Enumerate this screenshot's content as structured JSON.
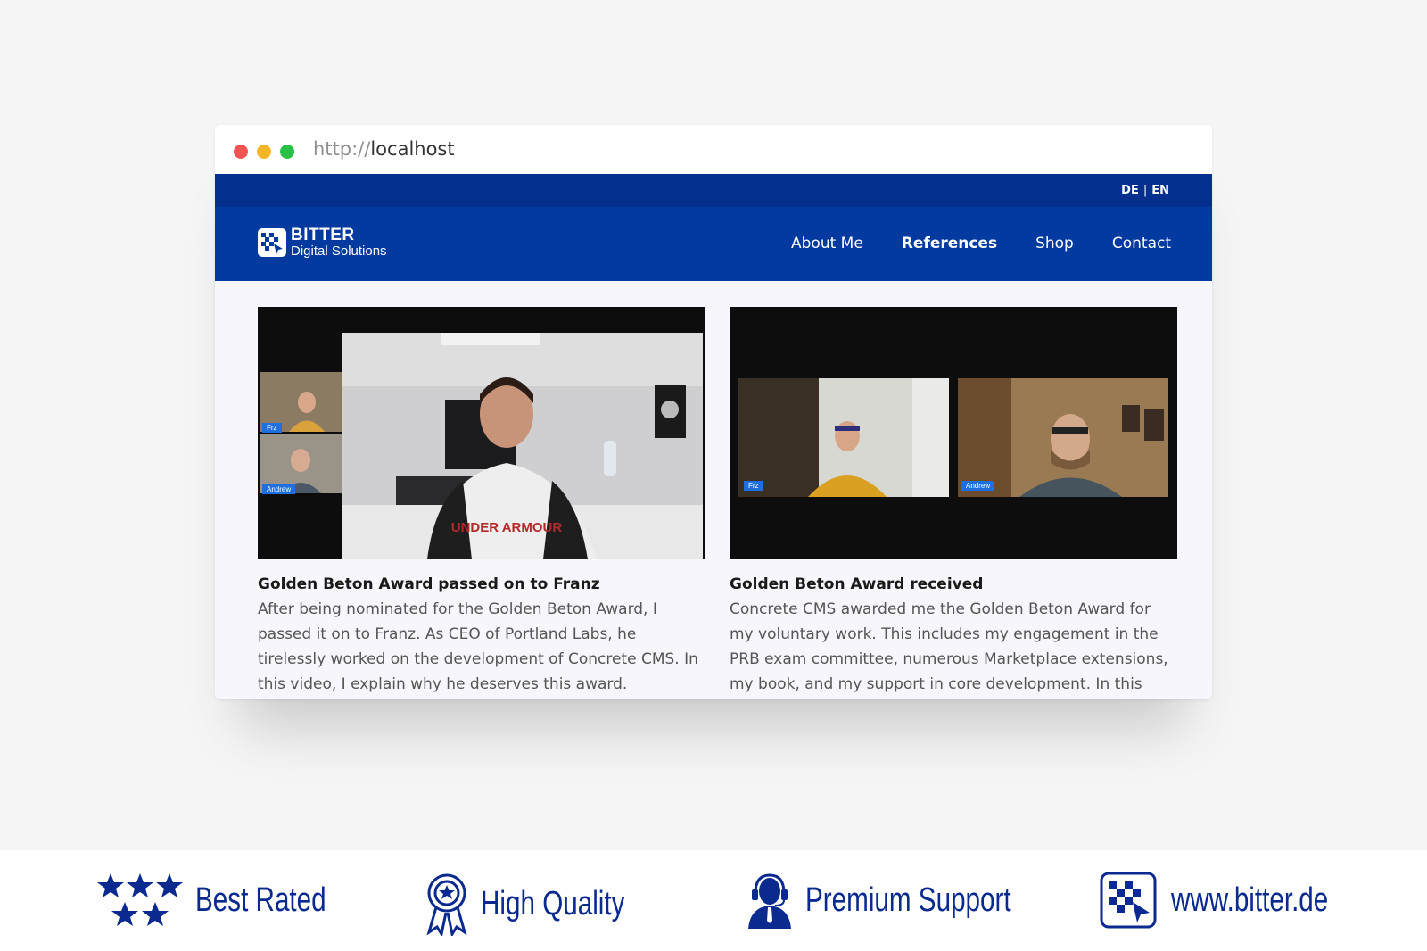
{
  "browser": {
    "url_protocol": "http://",
    "url_host": "localhost"
  },
  "site": {
    "lang": {
      "de": "DE",
      "sep": "|",
      "en": "EN"
    },
    "logo": {
      "line1": "BITTER",
      "line2": "Digital Solutions"
    },
    "nav": [
      {
        "label": "About Me",
        "active": false
      },
      {
        "label": "References",
        "active": true
      },
      {
        "label": "Shop",
        "active": false
      },
      {
        "label": "Contact",
        "active": false
      }
    ],
    "cards": [
      {
        "title": "Golden Beton Award passed on to Franz",
        "text": "After being nominated for the Golden Beton Award, I passed it on to Franz. As CEO of Portland Labs, he tirelessly worked on the development of Concrete CMS. In this video, I explain why he deserves this award.",
        "video_tags": [
          "Frz",
          "Andrew"
        ]
      },
      {
        "title": "Golden Beton Award received",
        "text": "Concrete CMS awarded me the Golden Beton Award for my voluntary work. This includes my engagement in the PRB exam committee, numerous Marketplace extensions, my book, and my support in core development. In this",
        "video_tags": [
          "Frz",
          "Andrew"
        ]
      }
    ]
  },
  "footer": {
    "badges": [
      {
        "icon": "stars-icon",
        "label": "Best Rated"
      },
      {
        "icon": "award-rosette-icon",
        "label": "High Quality"
      },
      {
        "icon": "support-agent-icon",
        "label": "Premium Support"
      },
      {
        "icon": "bitter-logo-icon",
        "label": "www.bitter.de"
      }
    ]
  },
  "colors": {
    "topbar": "#032f8f",
    "navbar": "#033a9f",
    "footer_text": "#0a2a8f",
    "tag": "#1f6fe0"
  }
}
